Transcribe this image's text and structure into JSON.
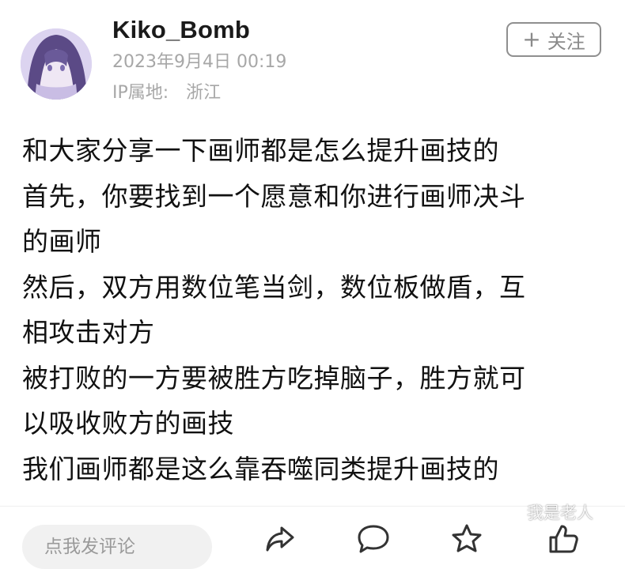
{
  "author": {
    "username": "Kiko_Bomb",
    "date": "2023年9月4日 00:19",
    "ip_label": "IP属地:",
    "ip_value": "浙江",
    "avatar_icon": "avatar-anime-girl-icon"
  },
  "follow_button": {
    "icon": "plus-icon",
    "label": "关注"
  },
  "post": {
    "lines": [
      "和大家分享一下画师都是怎么提升画技的",
      "首先，你要找到一个愿意和你进行画师决斗",
      "的画师",
      "然后，双方用数位笔当剑，数位板做盾，互",
      "相攻击对方",
      "被打败的一方要被胜方吃掉脑子，胜方就可",
      "以吸收败方的画技",
      "我们画师都是这么靠吞噬同类提升画技的"
    ]
  },
  "bottom_bar": {
    "comment_placeholder": "点我发评论",
    "share_icon": "share-icon",
    "comment_icon": "comment-icon",
    "star_icon": "star-icon",
    "like_icon": "like-icon"
  },
  "watermark": "我是老人",
  "colors": {
    "text": "#111111",
    "meta": "#a7a7a7",
    "button_border": "#8f8f8f",
    "avatar_bg": "#d9d2ee"
  }
}
